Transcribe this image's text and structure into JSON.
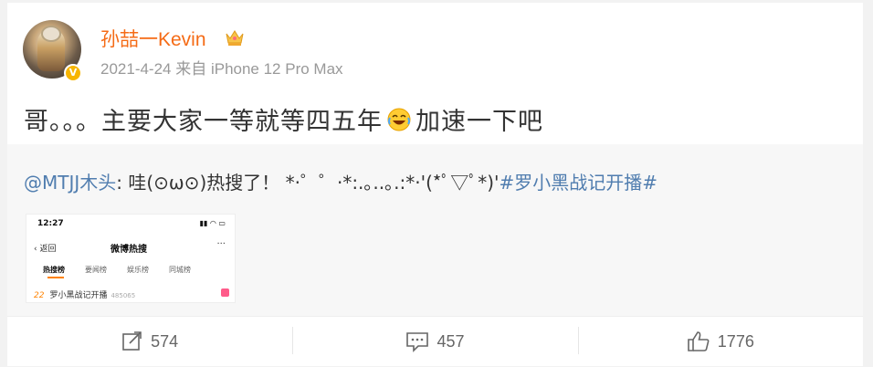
{
  "post": {
    "username": "孙喆一Kevin",
    "meta": "2021-4-24 来自 iPhone 12 Pro Max",
    "content_part1": "哥。。。主要大家一等就等四五年",
    "content_part2": "加速一下吧"
  },
  "repost": {
    "mention": "@MTJJ木头",
    "text": ": 哇(⊙ω⊙)热搜了！ *·゜゜·*:.｡..｡.:*·'(*ﾟ▽ﾟ*)'",
    "topic": "#罗小黑战记开播#",
    "thumbnail": {
      "time": "12:27",
      "status_icons": "▮▮ ◠ ▭",
      "back": "‹ 返回",
      "title": "微博热搜",
      "more": "···",
      "tabs": [
        "热搜榜",
        "要闻榜",
        "娱乐榜",
        "同城榜"
      ],
      "rank": "22",
      "item": "罗小黑战记开播",
      "count": "485065"
    }
  },
  "actions": {
    "repost_count": "574",
    "comment_count": "457",
    "like_count": "1776"
  },
  "colors": {
    "username": "#f56b16",
    "link": "#507daf",
    "verify_badge": "#f7b500"
  }
}
